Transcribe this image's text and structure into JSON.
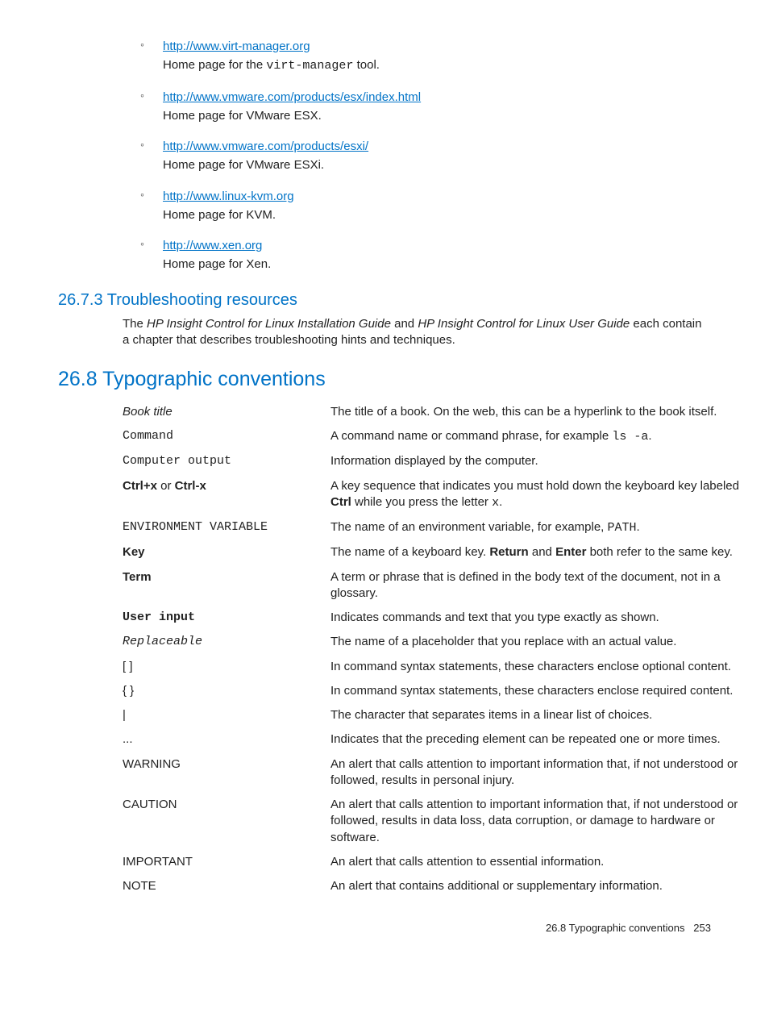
{
  "links": [
    {
      "url": "http://www.virt-manager.org",
      "desc_pre": "Home page for the ",
      "desc_mono": "virt-manager",
      "desc_post": " tool."
    },
    {
      "url": "http://www.vmware.com/products/esx/index.html",
      "desc": "Home page for VMware ESX."
    },
    {
      "url": "http://www.vmware.com/products/esxi/",
      "desc": "Home page for VMware ESXi."
    },
    {
      "url": "http://www.linux-kvm.org",
      "desc": "Home page for KVM."
    },
    {
      "url": "http://www.xen.org",
      "desc": "Home page for Xen."
    }
  ],
  "trouble_heading": "26.7.3 Troubleshooting resources",
  "trouble_p1_a": "The ",
  "trouble_p1_i1": "HP Insight Control for Linux Installation Guide",
  "trouble_p1_b": " and ",
  "trouble_p1_i2": "HP Insight Control for Linux User Guide",
  "trouble_p1_c": " each contain a chapter that describes troubleshooting hints and techniques.",
  "typo_heading": "26.8 Typographic conventions",
  "rows": {
    "book_title_term": "Book title",
    "book_title_def": "The title of a book. On the web, this can be a hyperlink to the book itself.",
    "command_term": "Command",
    "command_def_a": "A command name or command phrase, for example ",
    "command_def_mono": "ls -a",
    "command_def_b": ".",
    "comp_out_term": "Computer output",
    "comp_out_def": "Information displayed by the computer.",
    "ctrl_term_a": "Ctrl+x",
    "ctrl_term_mid": " or ",
    "ctrl_term_b": "Ctrl-x",
    "ctrl_def_a": "A key sequence that indicates you must hold down the keyboard key labeled ",
    "ctrl_def_bold": "Ctrl",
    "ctrl_def_b": " while you press the letter ",
    "ctrl_def_mono": "x",
    "ctrl_def_c": ".",
    "env_term": "ENVIRONMENT VARIABLE",
    "env_def_a": "The name of an environment variable, for example, ",
    "env_def_mono": "PATH",
    "env_def_b": ".",
    "key_term": "Key",
    "key_def_a": "The name of a keyboard key. ",
    "key_def_b1": "Return",
    "key_def_mid": " and ",
    "key_def_b2": "Enter",
    "key_def_c": " both refer to the same key.",
    "term_term": "Term",
    "term_def": "A term or phrase that is defined in the body text of the document, not in a glossary.",
    "user_input_term": "User input",
    "user_input_def": "Indicates commands and text that you type exactly as shown.",
    "repl_term": "Replaceable",
    "repl_def": "The name of a placeholder that you replace with an actual value.",
    "sqb_term": "[ ]",
    "sqb_def": "In command syntax statements, these characters enclose optional content.",
    "cb_term": "{ }",
    "cb_def": "In command syntax statements, these characters enclose required content.",
    "pipe_term": "|",
    "pipe_def": "The character that separates items in a linear list of choices.",
    "ell_term": "...",
    "ell_def": "Indicates that the preceding element can be repeated one or more times.",
    "warn_term": "WARNING",
    "warn_def": "An alert that calls attention to important information that, if not understood or followed, results in personal injury.",
    "caut_term": "CAUTION",
    "caut_def": "An alert that calls attention to important information that, if not understood or followed, results in data loss, data corruption, or damage to hardware or software.",
    "imp_term": "IMPORTANT",
    "imp_def": "An alert that calls attention to essential information.",
    "note_term": "NOTE",
    "note_def": "An alert that contains additional or supplementary information."
  },
  "footer_label": "26.8 Typographic conventions",
  "footer_page": "253"
}
